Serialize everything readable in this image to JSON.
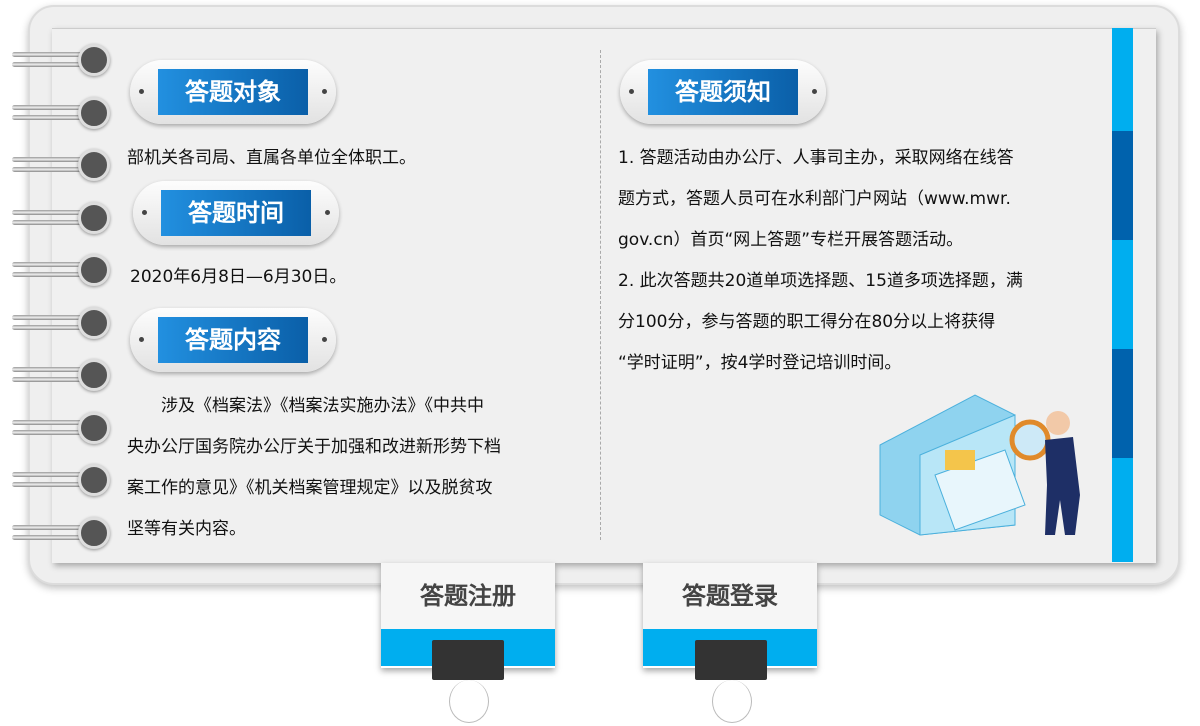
{
  "left": {
    "sections": [
      {
        "title": "答题对象",
        "body": "部机关各司局、直属各单位全体职工。"
      },
      {
        "title": "答题时间",
        "body": "2020年6月8日—6月30日。"
      },
      {
        "title": "答题内容",
        "lines": [
          "　　涉及《档案法》《档案法实施办法》《中共中",
          "央办公厅国务院办公厅关于加强和改进新形势下档",
          "案工作的意见》《机关档案管理规定》以及脱贫攻",
          "坚等有关内容。"
        ]
      }
    ]
  },
  "right": {
    "title": "答题须知",
    "lines": [
      "1. 答题活动由办公厅、人事司主办，采取网络在线答",
      "题方式，答题人员可在水利部门户网站（www.mwr.",
      "gov.cn）首页“网上答题”专栏开展答题活动。",
      "2. 此次答题共20道单项选择题、15道多项选择题，满",
      "分100分，参与答题的职工得分在80分以上将获得",
      "“学时证明”，按4学时登记培训时间。"
    ]
  },
  "buttons": {
    "register": "答题注册",
    "login": "答题登录"
  },
  "colors": {
    "accent": "#00aeef",
    "dark_blue": "#0062ad",
    "label_blue": "#1a80d0"
  }
}
